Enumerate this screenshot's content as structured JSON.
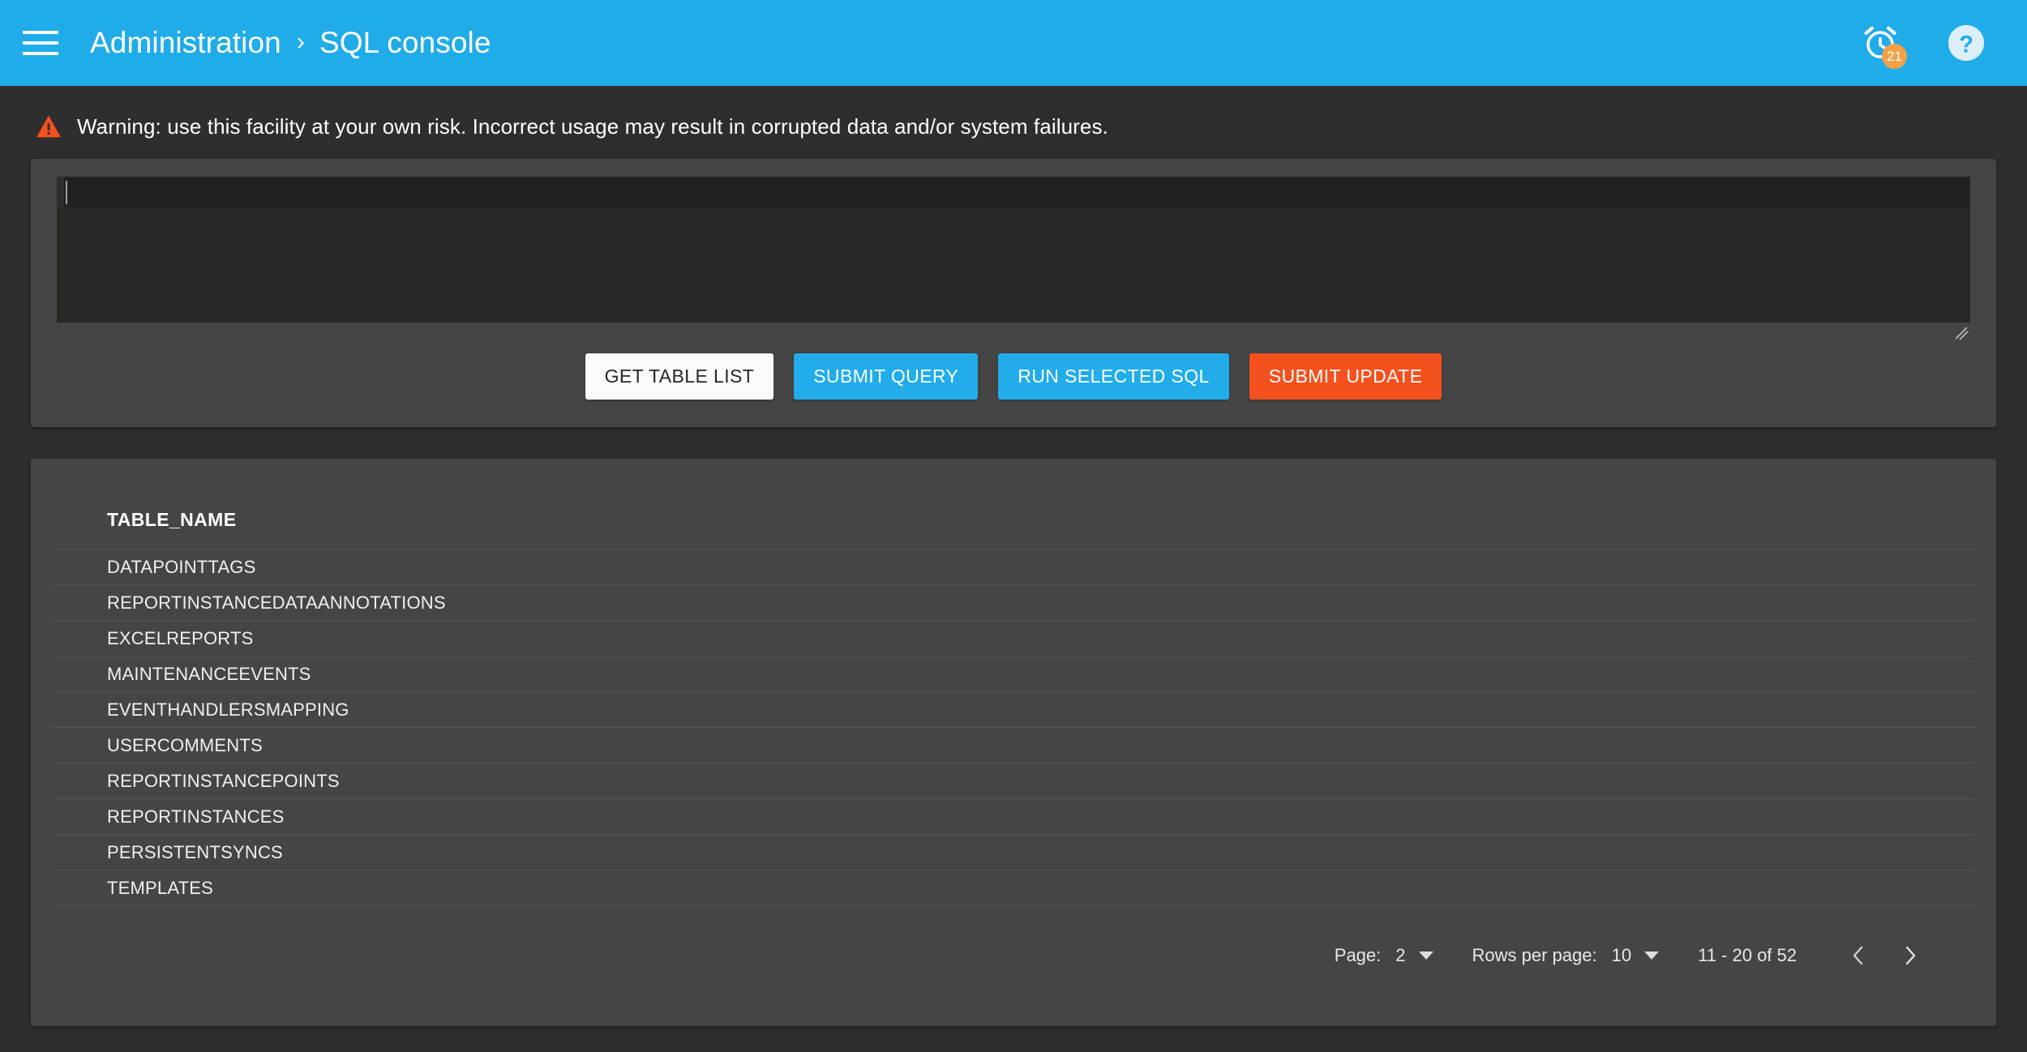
{
  "appbar": {
    "menu_icon": "hamburger-menu-icon",
    "breadcrumb": {
      "root": "Administration",
      "separator": "›",
      "current": "SQL console"
    },
    "alarms": {
      "icon": "alarm-clock-icon",
      "badge_count": "21",
      "badge_color": "#f5a044"
    },
    "help": {
      "icon": "help-circle-icon",
      "label": "?"
    },
    "background_color": "#20ace9"
  },
  "warning": {
    "icon": "warning-triangle-icon",
    "icon_color": "#f4511e",
    "text": "Warning: use this facility at your own risk. Incorrect usage may result in corrupted data and/or system failures."
  },
  "editor": {
    "value": "",
    "placeholder": "",
    "background_color": "#272924",
    "active_line_color": "#212121",
    "resize_handle": "resize-grip-icon"
  },
  "buttons": [
    {
      "label": "GET TABLE LIST",
      "style": "light",
      "color": "#fafafa"
    },
    {
      "label": "SUBMIT QUERY",
      "style": "blue",
      "color": "#22ace9"
    },
    {
      "label": "RUN SELECTED SQL",
      "style": "blue",
      "color": "#22ace9"
    },
    {
      "label": "SUBMIT UPDATE",
      "style": "orange",
      "color": "#f4511e"
    }
  ],
  "results": {
    "columns": [
      "TABLE_NAME"
    ],
    "rows": [
      "DATAPOINTTAGS",
      "REPORTINSTANCEDATAANNOTATIONS",
      "EXCELREPORTS",
      "MAINTENANCEEVENTS",
      "EVENTHANDLERSMAPPING",
      "USERCOMMENTS",
      "REPORTINSTANCEPOINTS",
      "REPORTINSTANCES",
      "PERSISTENTSYNCS",
      "TEMPLATES"
    ]
  },
  "paginator": {
    "page_label": "Page:",
    "page_value": "2",
    "rows_per_page_label": "Rows per page:",
    "rows_per_page_value": "10",
    "range_text": "11 - 20 of 52",
    "prev_icon": "chevron-left-icon",
    "next_icon": "chevron-right-icon"
  }
}
